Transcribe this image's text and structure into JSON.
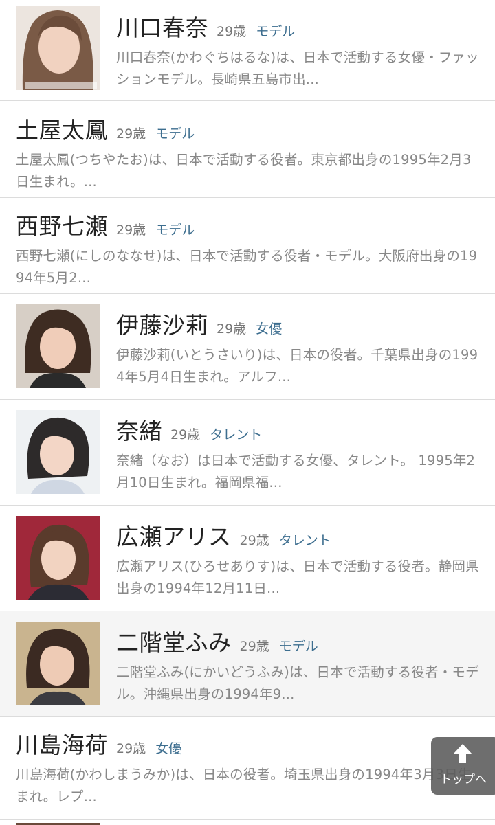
{
  "people": [
    {
      "name": "川口春奈",
      "age": "29歳",
      "category": "モデル",
      "desc": "川口春奈(かわぐちはるな)は、日本で活動する女優・ファッションモデル。長崎県五島市出...",
      "photo": true
    },
    {
      "name": "土屋太鳳",
      "age": "29歳",
      "category": "モデル",
      "desc": "土屋太鳳(つちやたお)は、日本で活動する役者。東京都出身の1995年2月3日生まれ。...",
      "photo": false
    },
    {
      "name": "西野七瀬",
      "age": "29歳",
      "category": "モデル",
      "desc": "西野七瀬(にしのななせ)は、日本で活動する役者・モデル。大阪府出身の1994年5月2...",
      "photo": false
    },
    {
      "name": "伊藤沙莉",
      "age": "29歳",
      "category": "女優",
      "desc": "伊藤沙莉(いとうさいり)は、日本の役者。千葉県出身の1994年5月4日生まれ。アルフ...",
      "photo": true
    },
    {
      "name": "奈緒",
      "age": "29歳",
      "category": "タレント",
      "desc": "奈緒（なお）は日本で活動する女優、タレント。 1995年2月10日生まれ。福岡県福...",
      "photo": true
    },
    {
      "name": "広瀬アリス",
      "age": "29歳",
      "category": "タレント",
      "desc": "広瀬アリス(ひろせありす)は、日本で活動する役者。静岡県出身の1994年12月11日...",
      "photo": true
    },
    {
      "name": "二階堂ふみ",
      "age": "29歳",
      "category": "モデル",
      "desc": "二階堂ふみ(にかいどうふみ)は、日本で活動する役者・モデル。沖縄県出身の1994年9...",
      "photo": true
    },
    {
      "name": "川島海荷",
      "age": "29歳",
      "category": "女優",
      "desc": "川島海荷(かわしまうみか)は、日本の役者。埼玉県出身の1994年3月3日生まれ。レプ...",
      "photo": false
    }
  ],
  "to_top": {
    "label": "トップへ",
    "icon": "arrow-up-icon"
  },
  "colors": {
    "category": "#3d6e8f",
    "age": "#777777",
    "desc": "#888888",
    "name": "#222222"
  }
}
